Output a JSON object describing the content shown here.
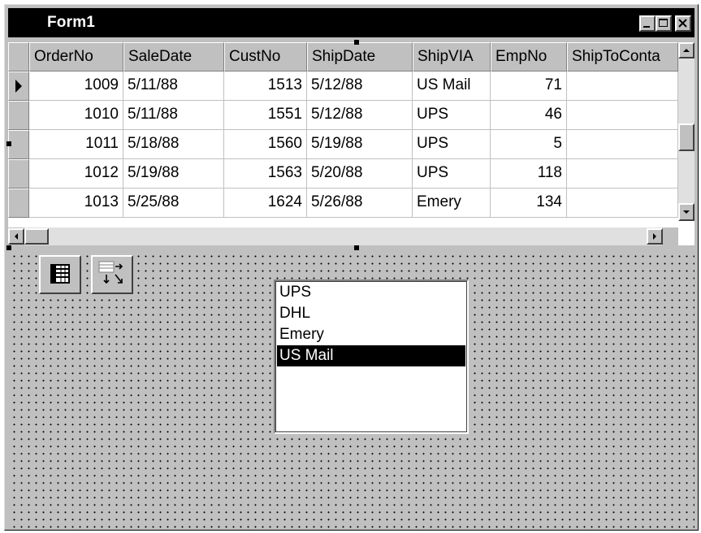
{
  "window": {
    "title": "Form1",
    "controls": [
      "minimize-icon",
      "maximize-icon",
      "close-icon"
    ]
  },
  "grid": {
    "columns": [
      "OrderNo",
      "SaleDate",
      "CustNo",
      "ShipDate",
      "ShipVIA",
      "EmpNo",
      "ShipToConta"
    ],
    "rows": [
      {
        "OrderNo": "1009",
        "SaleDate": "5/11/88",
        "CustNo": "1513",
        "ShipDate": "5/12/88",
        "ShipVIA": "US Mail",
        "EmpNo": "71",
        "ShipToConta": ""
      },
      {
        "OrderNo": "1010",
        "SaleDate": "5/11/88",
        "CustNo": "1551",
        "ShipDate": "5/12/88",
        "ShipVIA": "UPS",
        "EmpNo": "46",
        "ShipToConta": ""
      },
      {
        "OrderNo": "1011",
        "SaleDate": "5/18/88",
        "CustNo": "1560",
        "ShipDate": "5/19/88",
        "ShipVIA": "UPS",
        "EmpNo": "5",
        "ShipToConta": ""
      },
      {
        "OrderNo": "1012",
        "SaleDate": "5/19/88",
        "CustNo": "1563",
        "ShipDate": "5/20/88",
        "ShipVIA": "UPS",
        "EmpNo": "118",
        "ShipToConta": ""
      },
      {
        "OrderNo": "1013",
        "SaleDate": "5/25/88",
        "CustNo": "1624",
        "ShipDate": "5/26/88",
        "ShipVIA": "Emery",
        "EmpNo": "134",
        "ShipToConta": ""
      }
    ],
    "current_row_indicator": "arrow-right-icon",
    "current_row": 0
  },
  "toolbar": {
    "icons": [
      "table-icon",
      "data-transfer-icon"
    ]
  },
  "listbox": {
    "items": [
      "UPS",
      "DHL",
      "Emery",
      "US Mail"
    ],
    "selected_index": 3
  },
  "colors": {
    "title_bar": "#000000",
    "face": "#c0c0c0",
    "selection": "#000000"
  }
}
